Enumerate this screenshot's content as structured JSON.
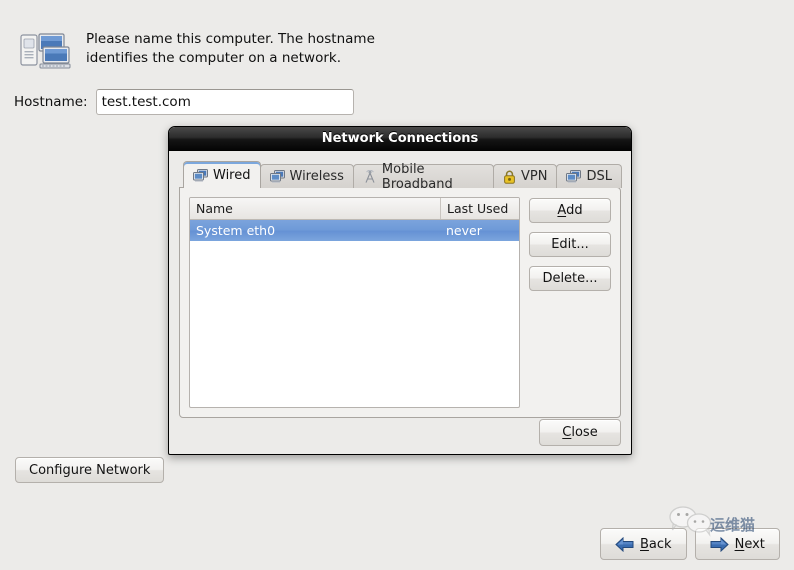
{
  "page": {
    "instruction": "Please name this computer.  The hostname identifies the computer on a network.",
    "computers_icon": "computers-network-icon",
    "hostname_label": "Hostname:",
    "hostname_value": "test.test.com",
    "hostname_placeholder": "",
    "configure_network_label": "Configure Network",
    "background_color": "#ecebe9"
  },
  "nav": {
    "back_label": "Back",
    "back_mnemonic": "B",
    "next_label": "Next",
    "next_mnemonic": "N",
    "back_icon": "arrow-left-icon",
    "next_icon": "arrow-right-icon",
    "accent_color": "#2b5fa8"
  },
  "dialog": {
    "title": "Network Connections",
    "titlebar_color": "#121212",
    "tabs": [
      {
        "label": "Wired",
        "icon": "wired-network-icon",
        "active": true
      },
      {
        "label": "Wireless",
        "icon": "wireless-network-icon",
        "active": false
      },
      {
        "label": "Mobile Broadband",
        "icon": "antenna-tower-icon",
        "active": false
      },
      {
        "label": "VPN",
        "icon": "padlock-icon",
        "active": false
      },
      {
        "label": "DSL",
        "icon": "dsl-network-icon",
        "active": false
      }
    ],
    "list": {
      "columns": [
        "Name",
        "Last Used"
      ],
      "rows": [
        {
          "name": "System eth0",
          "last_used": "never",
          "selected": true
        }
      ],
      "selection_color": "#6e9ad8"
    },
    "side_buttons": [
      {
        "label": "Add",
        "mnemonic": "A"
      },
      {
        "label": "Edit...",
        "mnemonic": ""
      },
      {
        "label": "Delete...",
        "mnemonic": ""
      }
    ],
    "close_label": "Close",
    "close_mnemonic": "C"
  },
  "watermark": {
    "text": "运维猫",
    "logo_icon": "wechat-bubbles-icon",
    "color": "#1f3f6b"
  }
}
